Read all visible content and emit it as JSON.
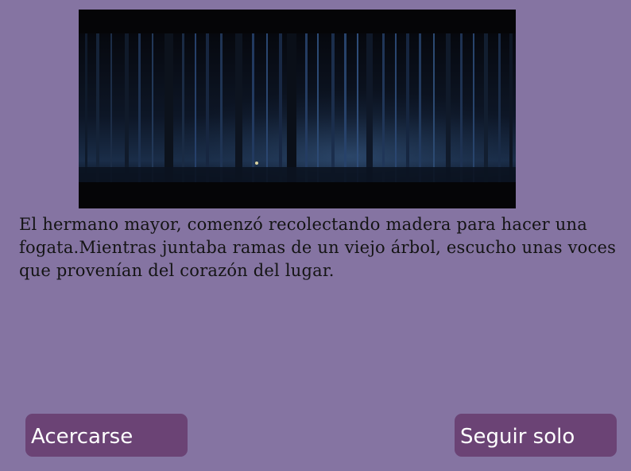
{
  "scene": {
    "image": "dark-night-forest-image"
  },
  "story": {
    "text": "El hermano mayor, comenzó recolectando madera para hacer una fogata.Mientras juntaba ramas de un viejo árbol, escucho unas voces que provenían del corazón del lugar."
  },
  "choices": [
    {
      "label": "Acercarse"
    },
    {
      "label": "Seguir solo"
    }
  ],
  "colors": {
    "background": "#8574a2",
    "button": "#6b4375",
    "button_text": "#ffffff",
    "text": "#141414"
  }
}
